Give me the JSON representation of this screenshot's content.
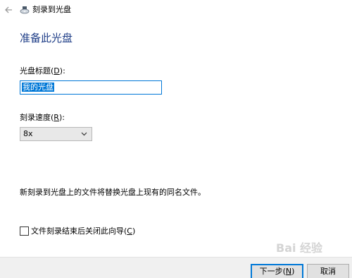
{
  "window": {
    "title": "刻录到光盘",
    "back_icon": "back-arrow-icon",
    "app_icon": "disc-burner-icon"
  },
  "main": {
    "heading": "准备此光盘",
    "disc_title": {
      "label": "光盘标题(",
      "accesskey": "D",
      "label_suffix": "):",
      "value": "我的光盘"
    },
    "burn_speed": {
      "label": "刻录速度(",
      "accesskey": "R",
      "label_suffix": "):",
      "selected": "8x"
    },
    "note": "新刻录到光盘上的文件将替换光盘上现有的同名文件。",
    "close_wizard": {
      "label": "文件刻录结束后关闭此向导(",
      "accesskey": "C",
      "label_suffix": ")",
      "checked": false
    }
  },
  "footer": {
    "next": {
      "label": "下一步(",
      "accesskey": "N",
      "suffix": ")"
    },
    "cancel": {
      "label": "取消"
    }
  },
  "watermark": "Bai 经验",
  "colors": {
    "heading": "#1e3d87",
    "accent": "#0078d7",
    "footer_bg": "#f0f0f0"
  }
}
